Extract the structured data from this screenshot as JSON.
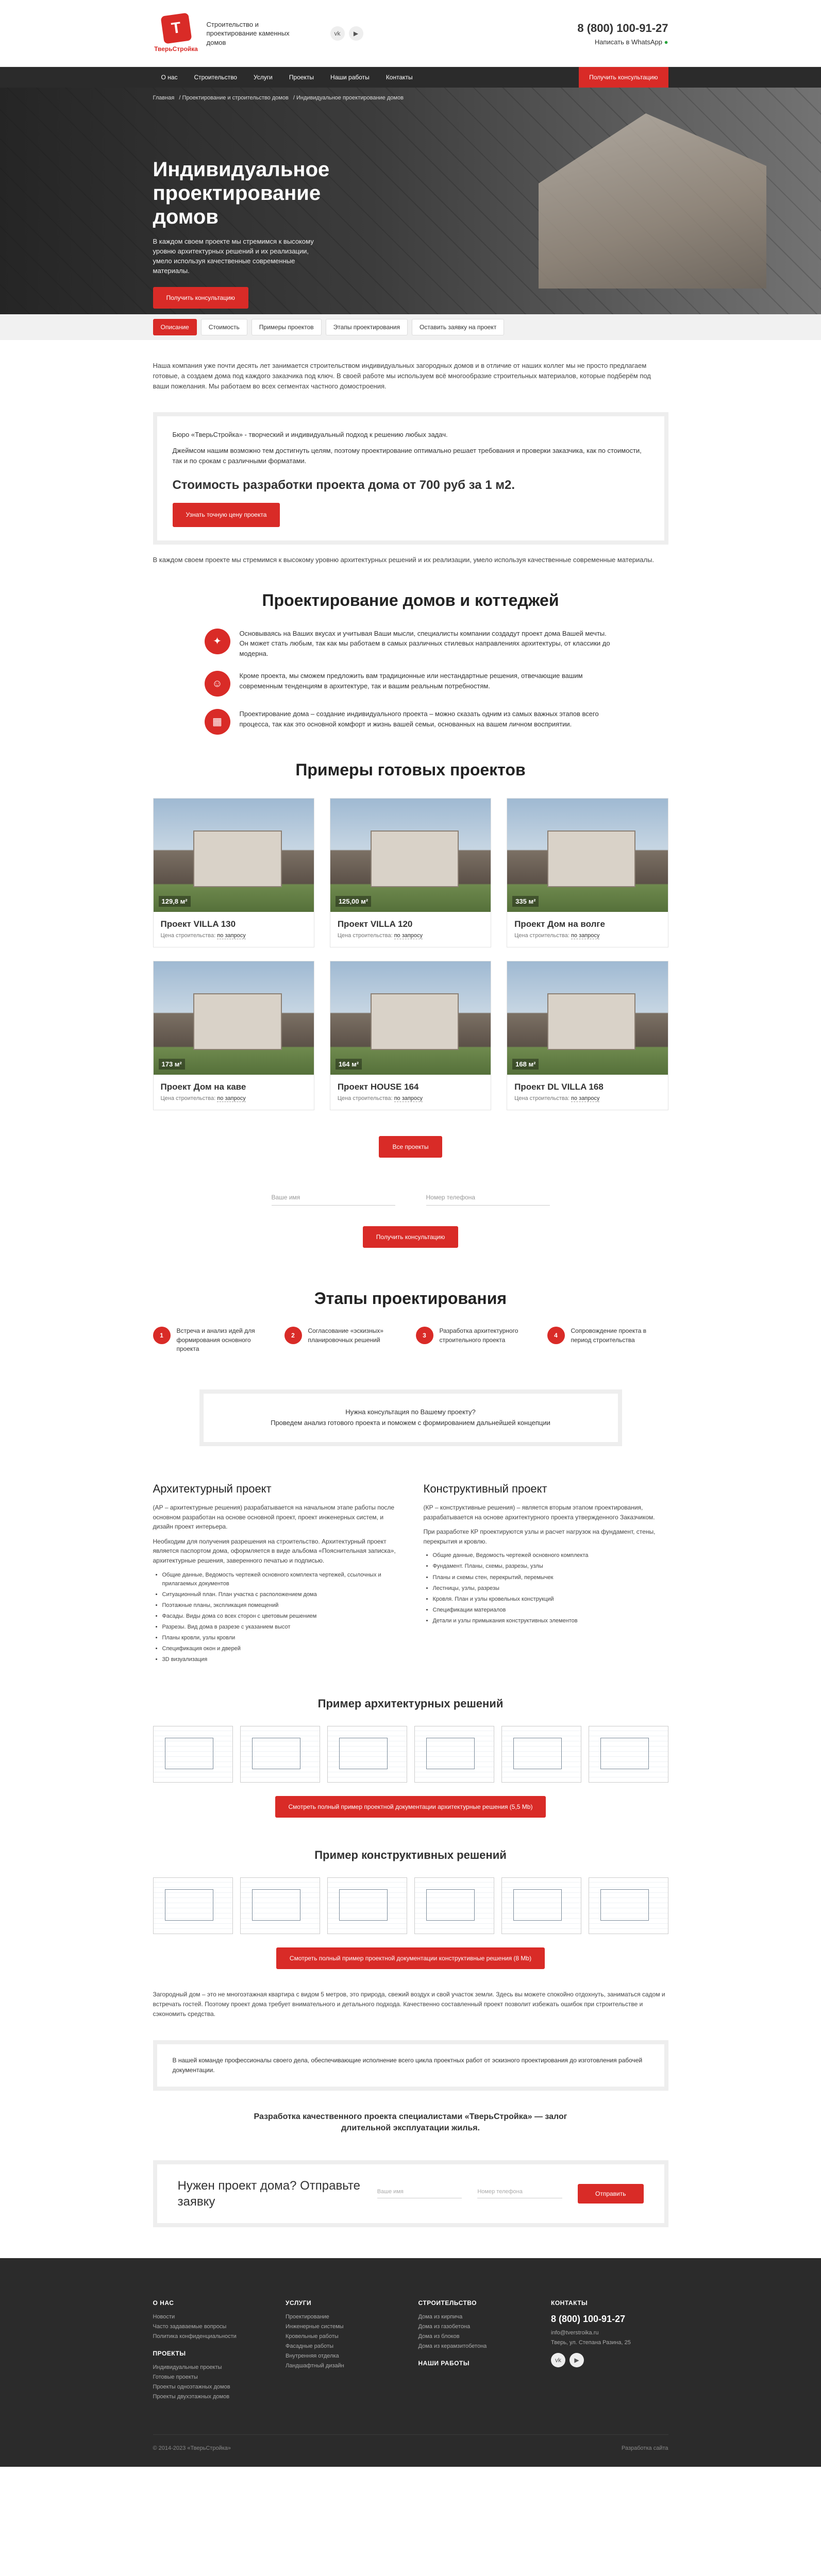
{
  "header": {
    "logo_text": "ТверьСтройка",
    "tagline": "Строительство и проектирование каменных домов",
    "phone": "8 (800) 100-91-27",
    "whatsapp": "Написать в WhatsApp"
  },
  "nav": {
    "items": [
      "О нас",
      "Строительство",
      "Услуги",
      "Проекты",
      "Наши работы",
      "Контакты"
    ],
    "cta": "Получить консультацию"
  },
  "hero": {
    "breadcrumbs": [
      "Главная",
      "Проектирование и строительство домов",
      "Индивидуальное проектирование домов"
    ],
    "title": "Индивидуальное проектирование домов",
    "text": "В каждом своем проекте мы стремимся к высокому уровню архитектурных решений и их реализации, умело используя качественные современные материалы.",
    "button": "Получить консультацию"
  },
  "tabs": [
    "Описание",
    "Стоимость",
    "Примеры проектов",
    "Этапы проектирования",
    "Оставить заявку на проект"
  ],
  "intro": "Наша компания уже почти десять лет занимается строительством индивидуальных загородных домов и в отличие от наших коллег мы не просто предлагаем готовые, а создаем дома под каждого заказчика под ключ. В своей работе мы используем всё многообразие строительных материалов, которые подберём под ваши пожелания. Мы работаем во всех сегментах частного домостроения.",
  "box": {
    "line1": "Бюро «ТверьСтройка» - творческий и индивидуальный подход к решению любых задач.",
    "line2": "Джеймсом нашим возможно тем достигнуть целям, поэтому проектирование оптимально решает требования и проверки заказчика, как по стоимости, так и по срокам с различными форматами.",
    "price": "Стоимость разработки проекта дома от 700 руб за 1 м2.",
    "button": "Узнать точную цену проекта"
  },
  "after_box": "В каждом своем проекте мы стремимся к высокому уровню архитектурных решений и их реализации, умело используя качественные современные материалы.",
  "design": {
    "title": "Проектирование домов и коттеджей",
    "features": [
      "Основываясь на Ваших вкусах и учитывая Ваши мысли, специалисты компании создадут проект дома Вашей мечты. Он может стать любым, так как мы работаем в самых различных стилевых направлениях архитектуры, от классики до модерна.",
      "Кроме проекта, мы сможем предложить вам традиционные или нестандартные решения, отвечающие вашим современным тенденциям в архитектуре, так и вашим реальным потребностям.",
      "Проектирование дома – создание индивидуального проекта – можно сказать одним из самых важных этапов всего процесса, так как это основной комфорт и жизнь вашей семьи, основанных на вашем личном восприятии."
    ]
  },
  "examples": {
    "title": "Примеры готовых проектов",
    "price_label": "Цена строительства:",
    "price_value": "по запросу",
    "cards": [
      {
        "name": "Проект VILLA 130",
        "area": "129,8 м²"
      },
      {
        "name": "Проект VILLA 120",
        "area": "125,00 м²"
      },
      {
        "name": "Проект Дом на волге",
        "area": "335 м²"
      },
      {
        "name": "Проект Дом на каве",
        "area": "173 м²"
      },
      {
        "name": "Проект HOUSE 164",
        "area": "164 м²"
      },
      {
        "name": "Проект DL VILLA 168",
        "area": "168 м²"
      }
    ],
    "all_button": "Все проекты"
  },
  "form": {
    "name_placeholder": "Ваше имя",
    "phone_placeholder": "Номер телефона",
    "button": "Получить консультацию"
  },
  "stages": {
    "title": "Этапы проектирования",
    "items": [
      {
        "n": "1",
        "text": "Встреча и анализ идей для формирования основного проекта"
      },
      {
        "n": "2",
        "text": "Согласование «эскизных» планировочных решений"
      },
      {
        "n": "3",
        "text": "Разработка архитектурного строительного проекта"
      },
      {
        "n": "4",
        "text": "Сопровождение проекта в период строительства"
      }
    ]
  },
  "consult": {
    "line1": "Нужна консультация по Вашему проекту?",
    "line2": "Проведем анализ готового проекта и поможем с формированием дальнейшей концепции"
  },
  "columns": {
    "arch": {
      "title": "Архитектурный проект",
      "p1": "(АР – архитектурные решения) разрабатывается на начальном этапе работы после основном разработан на основе основной проект, проект инженерных систем, и дизайн проект интерьера.",
      "p2": "Необходим для получения разрешения на строительство. Архитектурный проект является паспортом дома, оформляется в виде альбома «Пояснительная записка», архитектурные решения, заверенного печатью и подписью.",
      "list": [
        "Общие данные, Ведомость чертежей основного комплекта чертежей, ссылочных и прилагаемых документов",
        "Ситуационный план. План участка с расположением дома",
        "Поэтажные планы, экспликация помещений",
        "Фасады. Виды дома со всех сторон с цветовым решением",
        "Разрезы. Вид дома в разрезе с указанием высот",
        "Планы кровли, узлы кровли",
        "Спецификация окон и дверей",
        "3D визуализация"
      ]
    },
    "constr": {
      "title": "Конструктивный проект",
      "p1": "(КР – конструктивные решения) – является вторым этапом проектирования, разрабатывается на основе архитектурного проекта утвержденного Заказчиком.",
      "p2": "При разработке КР проектируются узлы и расчет нагрузок на фундамент, стены, перекрытия и кровлю.",
      "list": [
        "Общие данные, Ведомость чертежей основного комплекта",
        "Фундамент. Планы, схемы, разрезы, узлы",
        "Планы и схемы стен, перекрытий, перемычек",
        "Лестницы, узлы, разрезы",
        "Кровля. План и узлы кровельных конструкций",
        "Спецификации материалов",
        "Детали и узлы примыкания конструктивных элементов"
      ]
    }
  },
  "arch_example": {
    "title": "Пример архитектурных решений",
    "button": "Смотреть полный пример проектной документации архитектурные решения (5,5 Mb)"
  },
  "constr_example": {
    "title": "Пример конструктивных решений",
    "button": "Смотреть полный пример проектной документации конструктивные решения (8 Mb)"
  },
  "closing": "Загородный дом – это не многоэтажная квартира с видом 5 метров, это природа, свежий воздух и свой участок земли. Здесь вы можете спокойно отдохнуть, заниматься садом и встречать гостей. Поэтому проект дома требует внимательного и детального подхода. Качественно составленный проект позволит избежать ошибок при строительстве и сэкономить средства.",
  "closing_box": "В нашей команде профессионалы своего дела, обеспечивающие исполнение всего цикла проектных работ от эскизного проектирования до изготовления рабочей документации.",
  "slogan": "Разработка качественного проекта специалистами «ТверьСтройка» — залог длительной эксплуатации жилья.",
  "request": {
    "question": "Нужен проект дома? Отправьте заявку",
    "name_placeholder": "Ваше имя",
    "phone_placeholder": "Номер телефона",
    "button": "Отправить"
  },
  "footer": {
    "col1_title": "О НАС",
    "col1": [
      "Новости",
      "Часто задаваемые вопросы",
      "Политика конфиденциальности"
    ],
    "col1b_title": "ПРОЕКТЫ",
    "col1b": [
      "Индивидуальные проекты",
      "Готовые проекты",
      "Проекты одноэтажных домов",
      "Проекты двухэтажных домов"
    ],
    "col2_title": "УСЛУГИ",
    "col2": [
      "Проектирование",
      "Инженерные системы",
      "Кровельные работы",
      "Фасадные работы",
      "Внутренняя отделка",
      "Ландшафтный дизайн"
    ],
    "col3_title": "СТРОИТЕЛЬСТВО",
    "col3": [
      "Дома из кирпича",
      "Дома из газобетона",
      "Дома из блоков",
      "Дома из керамзитобетона"
    ],
    "col3b_title": "НАШИ РАБОТЫ",
    "col4_title": "КОНТАКТЫ",
    "phone": "8 (800) 100-91-27",
    "email": "info@tverstroika.ru",
    "address": "Тверь, ул. Степана Разина, 25",
    "copyright": "© 2014-2023 «ТверьСтройка»",
    "dev": "Разработка сайта"
  }
}
